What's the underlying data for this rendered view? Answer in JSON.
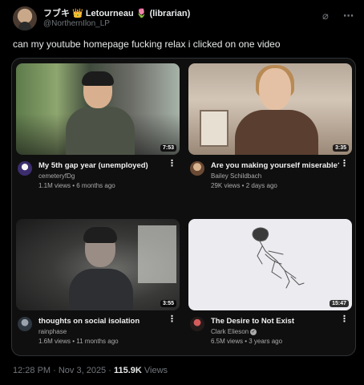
{
  "author": {
    "display_name": "フブキ",
    "name_suffix": "Letourneau",
    "tag": "(librarian)",
    "crown_emoji": "👑",
    "flower_emoji": "🌷",
    "handle": "@NorthernIlon_LP"
  },
  "header_icons": {
    "grok": "grok-icon",
    "more": "more-icon",
    "grok_glyph": "⌀",
    "more_glyph": "⋯"
  },
  "tweet_text": "can my youtube homepage fucking relax i clicked on one video",
  "videos": [
    {
      "title": "My 5th gap year (unemployed)",
      "channel": "cemeteryfDg",
      "meta": "1.1M views • 6 months ago",
      "duration": "7:53",
      "verified": false
    },
    {
      "title": "Are you making yourself miserable?",
      "channel": "Bailey Schildbach",
      "meta": "29K views • 2 days ago",
      "duration": "3:35",
      "verified": false
    },
    {
      "title": "thoughts on social isolation",
      "channel": "rainphase",
      "meta": "1.6M views • 11 months ago",
      "duration": "3:55",
      "verified": false
    },
    {
      "title": "The Desire to Not Exist",
      "channel": "Clark Elieson",
      "meta": "6.5M views • 3 years ago",
      "duration": "15:47",
      "verified": true
    }
  ],
  "footer": {
    "time": "12:28 PM · Nov 3, 2025 · ",
    "views_count": "115.9K",
    "views_label": " Views"
  }
}
